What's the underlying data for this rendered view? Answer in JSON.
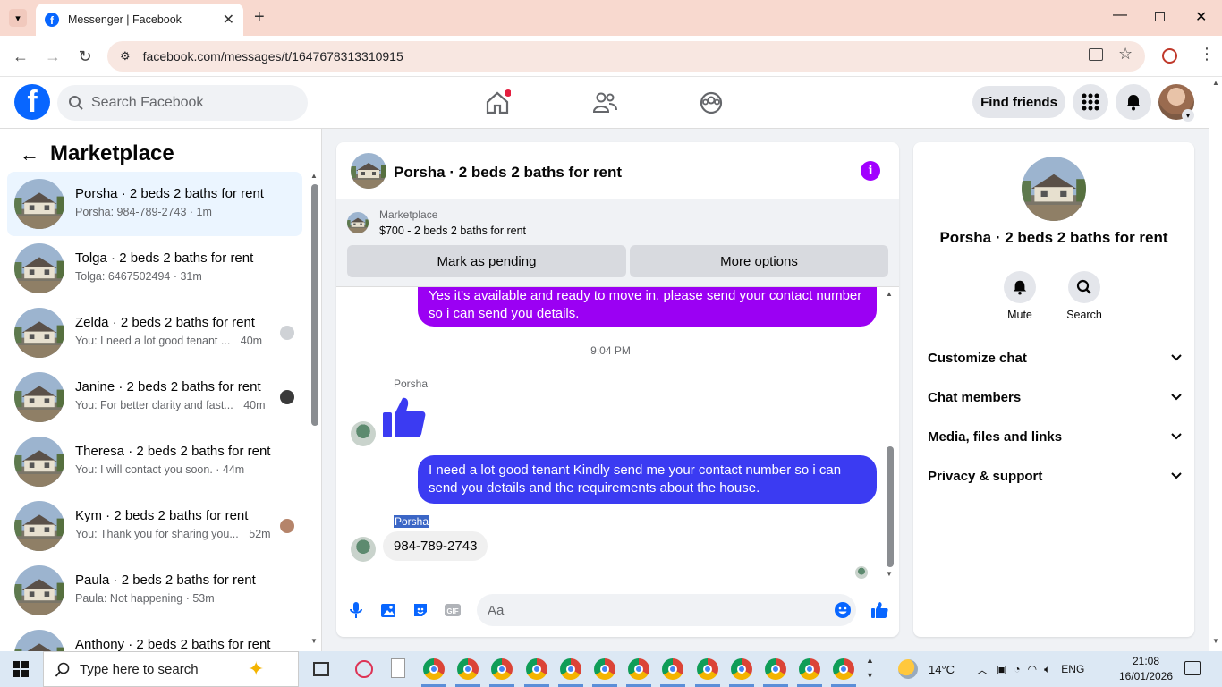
{
  "browser": {
    "tab_title": "Messenger | Facebook",
    "url": "facebook.com/messages/t/1647678313310915"
  },
  "header": {
    "search_placeholder": "Search Facebook",
    "find_friends": "Find friends",
    "brand_color": "#0866ff"
  },
  "sidebar": {
    "title": "Marketplace",
    "conversations": [
      {
        "name": "Porsha · 2 beds 2 baths for rent",
        "preview": "Porsha: 984-789-2743 · 1m",
        "active": true
      },
      {
        "name": "Tolga · 2 beds 2 baths for rent",
        "preview": "Tolga: 6467502494 · 31m"
      },
      {
        "name": "Zelda · 2 beds 2 baths for rent",
        "preview": "You: I need a lot good tenant ...",
        "time": "40m"
      },
      {
        "name": "Janine · 2 beds 2 baths for rent",
        "preview": "You: For better clarity and fast...",
        "time": "40m"
      },
      {
        "name": "Theresa · 2 beds 2 baths for rent",
        "preview": "You: I will contact you soon. · 44m"
      },
      {
        "name": "Kym · 2 beds 2 baths for rent",
        "preview": "You: Thank you for sharing you...",
        "time": "52m"
      },
      {
        "name": "Paula · 2 beds 2 baths for rent",
        "preview": "Paula: Not happening · 53m"
      },
      {
        "name": "Anthony · 2 beds 2 baths for rent",
        "preview": ""
      }
    ]
  },
  "chat": {
    "title": "Porsha · 2 beds 2 baths for rent",
    "banner_category": "Marketplace",
    "banner_listing": "$700 - 2 beds 2 baths for rent",
    "mark_pending": "Mark as pending",
    "more_options": "More options",
    "msg_out_1": "Yes it's available and ready to move in, please send your contact number so i can send you details.",
    "timestamp": "9:04 PM",
    "sender_1": "Porsha",
    "msg_out_2": "I need a lot good tenant Kindly send me your contact number so i can send you details and the requirements about the house.",
    "sender_2": "Porsha",
    "msg_in_phone": "984-789-2743",
    "composer_placeholder": "Aa"
  },
  "rpanel": {
    "name": "Porsha · 2 beds 2 baths for rent",
    "mute": "Mute",
    "search": "Search",
    "sections": [
      "Customize chat",
      "Chat members",
      "Media, files and links",
      "Privacy & support"
    ]
  },
  "taskbar": {
    "search_placeholder": "Type here to search",
    "temperature": "14°C",
    "language": "ENG",
    "time": "21:08",
    "date": "16/01/2026"
  }
}
